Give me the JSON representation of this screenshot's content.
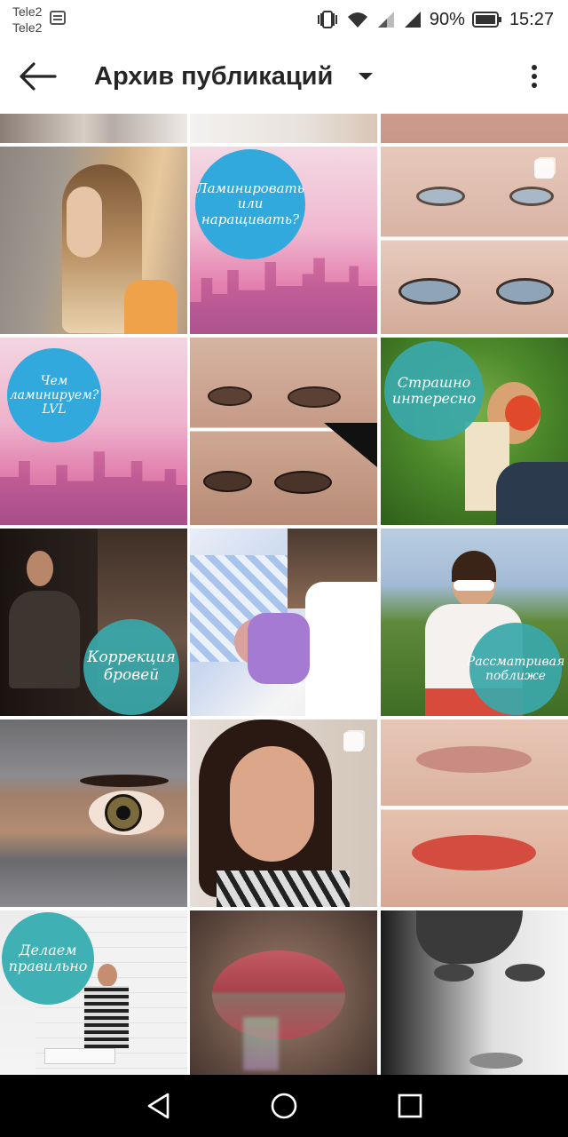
{
  "status_bar": {
    "carrier_1": "Tele2",
    "carrier_2": "Tele2",
    "battery": "90%",
    "time": "15:27"
  },
  "app_bar": {
    "title": "Архив публикаций",
    "back_icon": "arrow-left-icon",
    "dropdown_icon": "caret-down-icon",
    "more_icon": "more-vert-icon"
  },
  "grid": {
    "posts": [
      {
        "caption": ""
      },
      {
        "caption": ""
      },
      {
        "caption": ""
      },
      {
        "caption": ""
      },
      {
        "caption": "Ламинировать или наращивать?"
      },
      {
        "caption": ""
      },
      {
        "caption": "Чем ламинируем? LVL"
      },
      {
        "caption": ""
      },
      {
        "caption": "Страшно интересно"
      },
      {
        "caption": ""
      },
      {
        "caption": ""
      },
      {
        "caption": ""
      },
      {
        "caption": "Коррекция бровей"
      },
      {
        "caption": ""
      },
      {
        "caption": "Рассматривая поближе"
      },
      {
        "caption": ""
      },
      {
        "caption": ""
      },
      {
        "caption": ""
      },
      {
        "caption": "Делаем правильно"
      },
      {
        "caption": ""
      },
      {
        "caption": ""
      }
    ]
  },
  "nav_bar": {
    "back_icon": "triangle-back-icon",
    "home_icon": "circle-home-icon",
    "recents_icon": "square-recents-icon"
  },
  "colors": {
    "bubble_blue": "#31a9dd",
    "bubble_teal": "#3aa8aa",
    "title": "#262626"
  }
}
